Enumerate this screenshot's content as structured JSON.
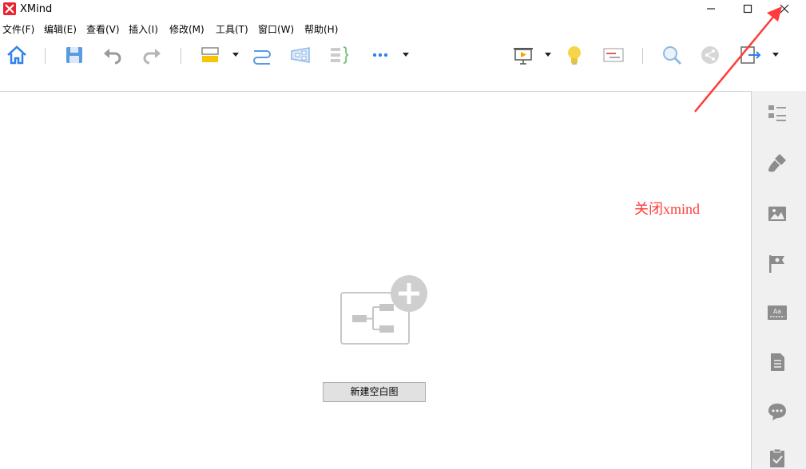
{
  "window": {
    "title": "XMind",
    "logo_color": "#e8232f",
    "controls": [
      "minimize-icon",
      "maximize-icon",
      "close-icon"
    ]
  },
  "menu": [
    {
      "label": "文件(F)"
    },
    {
      "label": "编辑(E)"
    },
    {
      "label": "查看(V)"
    },
    {
      "label": "插入(I)"
    },
    {
      "label": "修改(M)"
    },
    {
      "label": "工具(T)"
    },
    {
      "label": "窗口(W)"
    },
    {
      "label": "帮助(H)"
    }
  ],
  "toolbar": {
    "icons": [
      "home-icon",
      "save-icon",
      "undo-icon",
      "redo-icon",
      "topic-icon",
      "relationship-icon",
      "boundary-icon",
      "summary-icon",
      "more-icon",
      "presentation-icon",
      "brainstorm-icon",
      "gantt-icon",
      "search-icon",
      "share-icon",
      "export-icon"
    ],
    "accent": "#2f80ed",
    "highlight": "#f7c600"
  },
  "canvas": {
    "new_blank_map_label": "新建空白图"
  },
  "annotation": {
    "text": "关闭xmind",
    "color": "#ff3b3b"
  },
  "side_panel": {
    "icons": [
      "outline-icon",
      "format-icon",
      "image-icon",
      "marker-icon",
      "text-style-icon",
      "notes-icon",
      "comments-icon",
      "task-icon"
    ]
  }
}
